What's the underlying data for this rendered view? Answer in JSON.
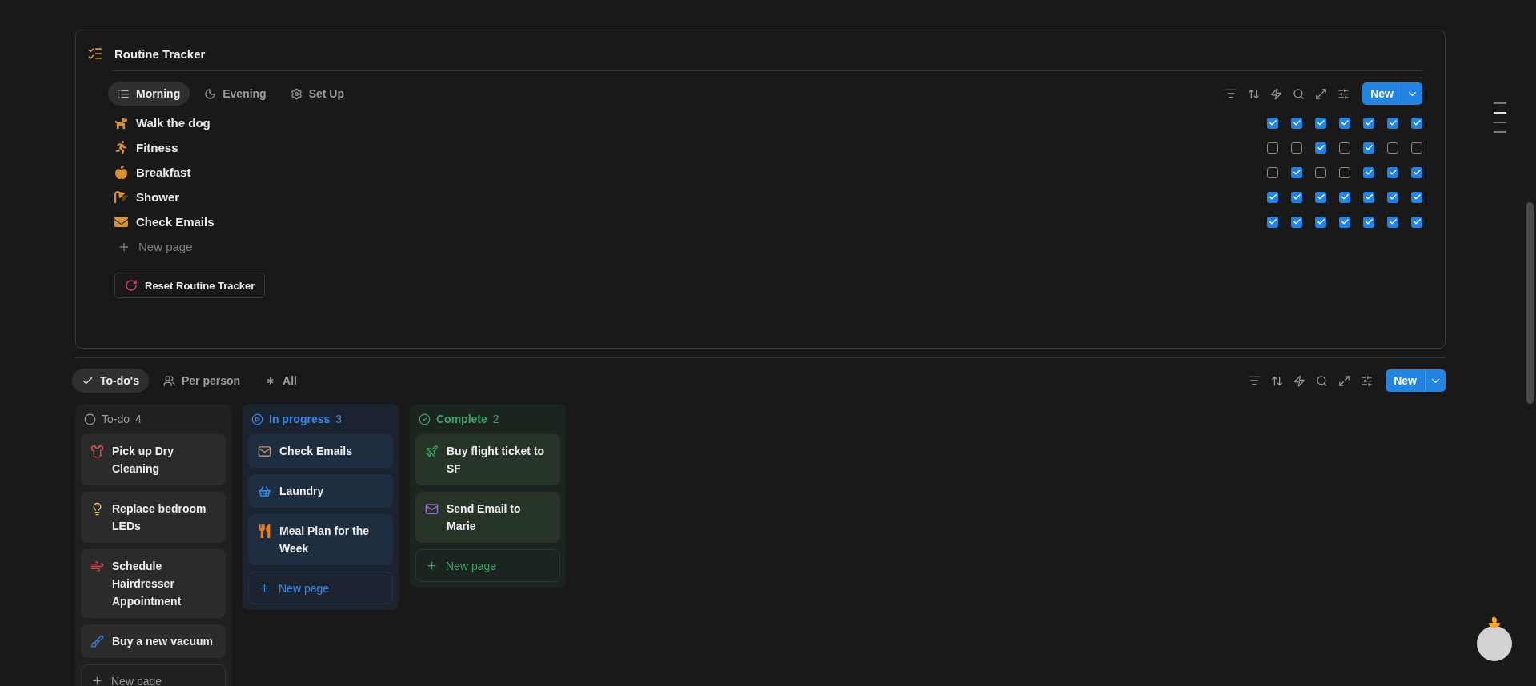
{
  "tracker": {
    "title": "Routine Tracker",
    "tabs": [
      {
        "label": "Morning",
        "kind": "list",
        "selected": true
      },
      {
        "label": "Evening",
        "kind": "moon",
        "selected": false
      },
      {
        "label": "Set Up",
        "kind": "gear",
        "selected": false
      }
    ],
    "new_button": "New",
    "rows": [
      {
        "name": "Walk the dog",
        "checks": [
          true,
          true,
          true,
          true,
          true,
          true,
          true
        ]
      },
      {
        "name": "Fitness",
        "checks": [
          false,
          false,
          true,
          false,
          true,
          false,
          false
        ]
      },
      {
        "name": "Breakfast",
        "checks": [
          false,
          true,
          false,
          false,
          true,
          true,
          true
        ]
      },
      {
        "name": "Shower",
        "checks": [
          true,
          true,
          true,
          true,
          true,
          true,
          true
        ]
      },
      {
        "name": "Check Emails",
        "checks": [
          true,
          true,
          true,
          true,
          true,
          true,
          true
        ]
      }
    ],
    "new_page": "New page",
    "reset_button": "Reset Routine Tracker"
  },
  "board": {
    "tabs": [
      {
        "label": "To-do's",
        "kind": "check",
        "selected": true
      },
      {
        "label": "Per person",
        "kind": "people",
        "selected": false
      },
      {
        "label": "All",
        "kind": "asterisk",
        "selected": false
      }
    ],
    "new_button": "New",
    "columns": [
      {
        "kind": "todo",
        "title": "To-do",
        "count": "4",
        "new_page": "New page",
        "cards": [
          {
            "title": "Pick up Dry Cleaning",
            "color": "#e0524f"
          },
          {
            "title": "Replace bedroom LEDs",
            "color": "#f2c94c"
          },
          {
            "title": "Schedule Hairdresser Appointment",
            "color": "#d9463f"
          },
          {
            "title": "Buy a new vacuum",
            "color": "#2f7fd6"
          }
        ]
      },
      {
        "kind": "progress",
        "title": "In progress",
        "count": "3",
        "new_page": "New page",
        "cards": [
          {
            "title": "Check Emails",
            "color": "#c88a6a"
          },
          {
            "title": "Laundry",
            "color": "#3d8fe0"
          },
          {
            "title": "Meal Plan for the Week",
            "color": "#e87b1e"
          }
        ]
      },
      {
        "kind": "done",
        "title": "Complete",
        "count": "2",
        "new_page": "New page",
        "cards": [
          {
            "title": "Buy flight ticket to SF",
            "color": "#3aa163"
          },
          {
            "title": "Send Email to Marie",
            "color": "#9a6dd7"
          }
        ]
      }
    ]
  }
}
